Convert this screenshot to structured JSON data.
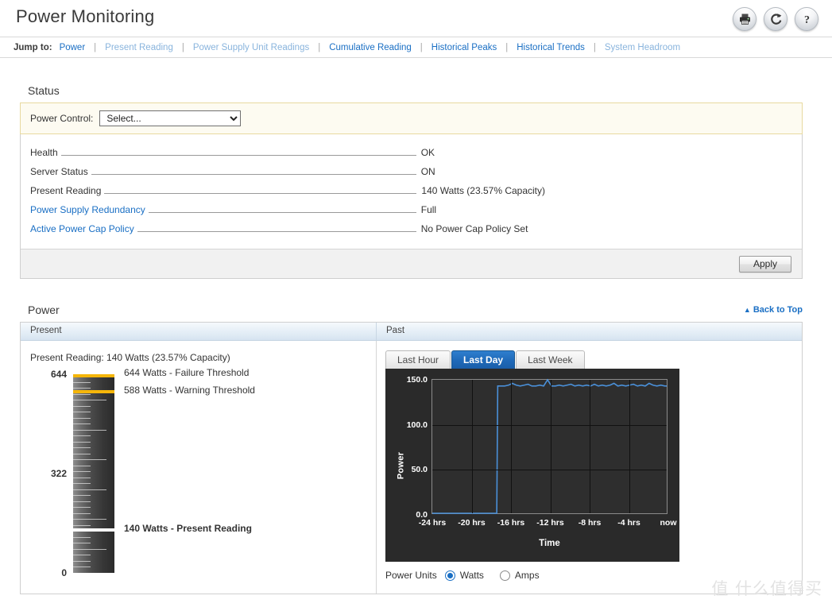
{
  "header": {
    "title": "Power Monitoring",
    "icons": [
      {
        "name": "print-icon",
        "label": "Print"
      },
      {
        "name": "refresh-icon",
        "label": "Refresh"
      },
      {
        "name": "help-icon",
        "label": "Help"
      }
    ]
  },
  "jumpbar": {
    "label": "Jump to:",
    "separator": "|",
    "links": [
      {
        "text": "Power",
        "dim": false
      },
      {
        "text": "Present Reading",
        "dim": true
      },
      {
        "text": "Power Supply Unit Readings",
        "dim": true
      },
      {
        "text": "Cumulative Reading",
        "dim": false
      },
      {
        "text": "Historical Peaks",
        "dim": false
      },
      {
        "text": "Historical Trends",
        "dim": false
      },
      {
        "text": "System Headroom",
        "dim": true
      }
    ]
  },
  "status": {
    "heading": "Status",
    "power_control_label": "Power Control:",
    "power_control_value": "Select...",
    "power_control_options": [
      "Select..."
    ],
    "rows": [
      {
        "label": "Health",
        "value": "OK",
        "is_link": false
      },
      {
        "label": "Server Status",
        "value": "ON",
        "is_link": false
      },
      {
        "label": "Present Reading",
        "value": "140 Watts (23.57% Capacity)",
        "is_link": false
      },
      {
        "label": "Power Supply Redundancy",
        "value": "Full",
        "is_link": true
      },
      {
        "label": "Active Power Cap Policy",
        "value": "No Power Cap Policy Set",
        "is_link": true
      }
    ],
    "apply_label": "Apply"
  },
  "power": {
    "heading": "Power",
    "back_to_top": "Back to Top",
    "back_to_top_caret": "▲",
    "col_present": "Present",
    "col_past": "Past",
    "present_reading_text": "Present Reading: 140 Watts (23.57% Capacity)",
    "gauge": {
      "max": 644,
      "min": 0,
      "scale_labels": [
        {
          "text": "644",
          "value": 644
        },
        {
          "text": "322",
          "value": 322
        },
        {
          "text": "0",
          "value": 0
        }
      ],
      "markers": [
        {
          "text": "644 Watts - Failure Threshold",
          "value": 644,
          "kind": "threshold",
          "bold": false
        },
        {
          "text": "588 Watts - Warning Threshold",
          "value": 588,
          "kind": "threshold",
          "bold": false
        },
        {
          "text": "140 Watts - Present Reading",
          "value": 140,
          "kind": "present",
          "bold": true
        }
      ]
    },
    "tabs": [
      {
        "label": "Last Hour",
        "active": false
      },
      {
        "label": "Last Day",
        "active": true
      },
      {
        "label": "Last Week",
        "active": false
      }
    ],
    "units_label": "Power Units",
    "units": [
      {
        "label": "Watts",
        "checked": true
      },
      {
        "label": "Amps",
        "checked": false
      }
    ]
  },
  "watermark": "值 什么值得买",
  "colors": {
    "link": "#1a6fc4",
    "link_dim": "#89b4dd",
    "tab_active": "#1f69b8",
    "threshold": "#f5b60a",
    "present_marker": "#ffffff",
    "chart_line": "#4a90d9",
    "chart_bg": "#2a2a2a",
    "panel_highlight": "#fdfbf1"
  },
  "chart_data": {
    "type": "line",
    "title": "",
    "xlabel": "Time",
    "ylabel": "Power",
    "ylim": [
      0,
      150
    ],
    "yticks": [
      0.0,
      50.0,
      100.0,
      150.0
    ],
    "ytick_labels": [
      "0.0",
      "50.0",
      "100.0",
      "150.0"
    ],
    "xticks": [
      -24,
      -20,
      -16,
      -12,
      -8,
      -4,
      0
    ],
    "xtick_labels": [
      "-24 hrs",
      "-20 hrs",
      "-16 hrs",
      "-12 hrs",
      "-8 hrs",
      "-4 hrs",
      "now"
    ],
    "xlim": [
      -24,
      0
    ],
    "grid": true,
    "legend": null,
    "series": [
      {
        "name": "Power",
        "color": "#4a90d9",
        "x": [
          -24,
          -23,
          -22,
          -21,
          -20,
          -19,
          -18,
          -17.4,
          -17.3,
          -17.0,
          -16.6,
          -16.2,
          -15.8,
          -15.4,
          -15.0,
          -14.6,
          -14.2,
          -13.8,
          -13.4,
          -13.0,
          -12.6,
          -12.2,
          -11.8,
          -11.4,
          -11.0,
          -10.6,
          -10.2,
          -9.8,
          -9.4,
          -9.0,
          -8.6,
          -8.2,
          -7.8,
          -7.4,
          -7.0,
          -6.6,
          -6.2,
          -5.8,
          -5.4,
          -5.0,
          -4.6,
          -4.2,
          -3.8,
          -3.4,
          -3.0,
          -2.6,
          -2.2,
          -1.8,
          -1.4,
          -1.0,
          -0.6,
          -0.2,
          0
        ],
        "y": [
          0,
          0,
          0,
          0,
          0,
          0,
          0,
          0,
          143,
          143,
          143,
          144,
          146,
          144,
          143,
          144,
          145,
          143,
          143,
          144,
          143,
          150,
          143,
          143,
          144,
          143,
          144,
          145,
          143,
          144,
          143,
          144,
          143,
          145,
          143,
          144,
          143,
          144,
          146,
          143,
          144,
          143,
          144,
          145,
          143,
          144,
          143,
          146,
          144,
          143,
          144,
          143,
          143
        ]
      }
    ]
  }
}
